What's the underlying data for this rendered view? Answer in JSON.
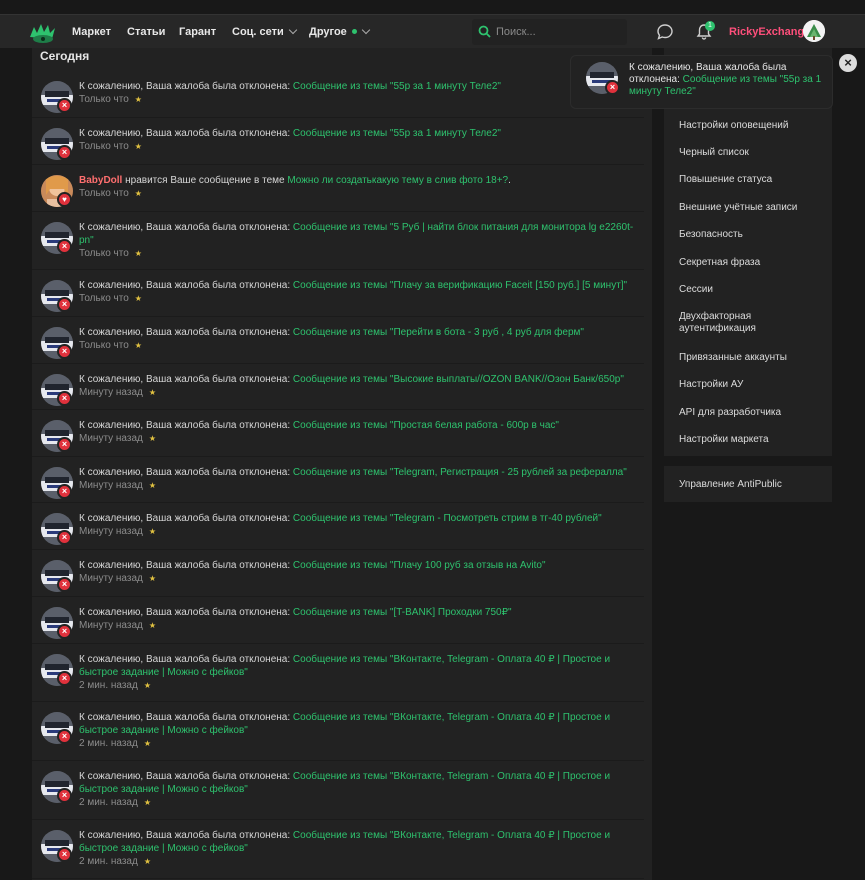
{
  "nav": {
    "items": [
      "Маркет",
      "Статьи",
      "Гарант",
      "Соц. сети",
      "Другое"
    ],
    "search_placeholder": "Поиск...",
    "alerts_count": "1",
    "username": "RickyExchange"
  },
  "colors": {
    "accent": "#2ec26e",
    "reject": "#e0313c",
    "like": "#e0313c",
    "username": "#ff4f7b"
  },
  "main": {
    "section_title": "Сегодня",
    "notifications": [
      {
        "type": "reject",
        "text": "К сожалению, Ваша жалоба была отклонена: ",
        "link": "Сообщение из темы \"55р за 1 минуту Теле2\"",
        "time": "Только что"
      },
      {
        "type": "reject",
        "text": "К сожалению, Ваша жалоба была отклонена: ",
        "link": "Сообщение из темы \"55р за 1 минуту Теле2\"",
        "time": "Только что"
      },
      {
        "type": "like",
        "user": "BabyDoll",
        "text": " нравится Ваше сообщение в теме ",
        "link": "Можно ли создатькакую тему в слив фото 18+?",
        "suffix": ".",
        "time": "Только что"
      },
      {
        "type": "reject",
        "text": "К сожалению, Ваша жалоба была отклонена: ",
        "link": "Сообщение из темы \"5 Руб | найти блок питания для монитора lg e2260t-pn\"",
        "time": "Только что"
      },
      {
        "type": "reject",
        "text": "К сожалению, Ваша жалоба была отклонена: ",
        "link": "Сообщение из темы \"Плачу за верификацию Faceit [150 руб.] [5 минут]\"",
        "time": "Только что"
      },
      {
        "type": "reject",
        "text": "К сожалению, Ваша жалоба была отклонена: ",
        "link": "Сообщение из темы \"Перейти в бота - 3 руб , 4 руб для ферм\"",
        "time": "Только что"
      },
      {
        "type": "reject",
        "text": "К сожалению, Ваша жалоба была отклонена: ",
        "link": "Сообщение из темы \"Высокие выплаты//OZON BANK//Озон Банк/650р\"",
        "time": "Минуту назад"
      },
      {
        "type": "reject",
        "text": "К сожалению, Ваша жалоба была отклонена: ",
        "link": "Сообщение из темы \"Простая 6елая работа - 600р в час\"",
        "time": "Минуту назад"
      },
      {
        "type": "reject",
        "text": "К сожалению, Ваша жалоба была отклонена: ",
        "link": "Сообщение из темы \"Telegram, Регистрация - 25 рублей за рефералла\"",
        "time": "Минуту назад"
      },
      {
        "type": "reject",
        "text": "К сожалению, Ваша жалоба была отклонена: ",
        "link": "Сообщение из темы \"Telegram - Посмотреть стрим в тг-40 рублей\"",
        "time": "Минуту назад"
      },
      {
        "type": "reject",
        "text": "К сожалению, Ваша жалоба была отклонена: ",
        "link": "Сообщение из темы \"Плачу 100 руб за отзыв на Avito\"",
        "time": "Минуту назад"
      },
      {
        "type": "reject",
        "text": "К сожалению, Ваша жалоба была отклонена: ",
        "link": "Сообщение из темы \"[T-BANK] Проходки 750₽\"",
        "time": "Минуту назад"
      },
      {
        "type": "reject",
        "text": "К сожалению, Ваша жалоба была отклонена: ",
        "link": "Сообщение из темы \"ВКонтакте, Telegram - Оплата 40 ₽ | Простое и быстрое задание | Можно с фейков\"",
        "time": "2 мин. назад"
      },
      {
        "type": "reject",
        "text": "К сожалению, Ваша жалоба была отклонена: ",
        "link": "Сообщение из темы \"ВКонтакте, Telegram - Оплата 40 ₽ | Простое и быстрое задание | Можно с фейков\"",
        "time": "2 мин. назад"
      },
      {
        "type": "reject",
        "text": "К сожалению, Ваша жалоба была отклонена: ",
        "link": "Сообщение из темы \"ВКонтакте, Telegram - Оплата 40 ₽ | Простое и быстрое задание | Можно с фейков\"",
        "time": "2 мин. назад"
      },
      {
        "type": "reject",
        "text": "К сожалению, Ваша жалоба была отклонена: ",
        "link": "Сообщение из темы \"ВКонтакте, Telegram - Оплата 40 ₽ | Простое и быстрое задание | Можно с фейков\"",
        "time": "2 мин. назад"
      }
    ]
  },
  "sidebar": {
    "items": [
      "Настройки оповещений",
      "Черный список",
      "Повышение статуса",
      "Внешние учётные записи",
      "Безопасность",
      "Секретная фраза",
      "Сессии",
      "Двухфакторная аутентификация",
      "Привязанные аккаунты",
      "Настройки АУ",
      "API для разработчика",
      "Настройки маркета"
    ],
    "extra_item": "Управление AntiPublic"
  },
  "toast": {
    "text": "К сожалению, Ваша жалоба была отклонена: ",
    "link": "Сообщение из темы \"55р за 1 минуту Теле2\""
  }
}
